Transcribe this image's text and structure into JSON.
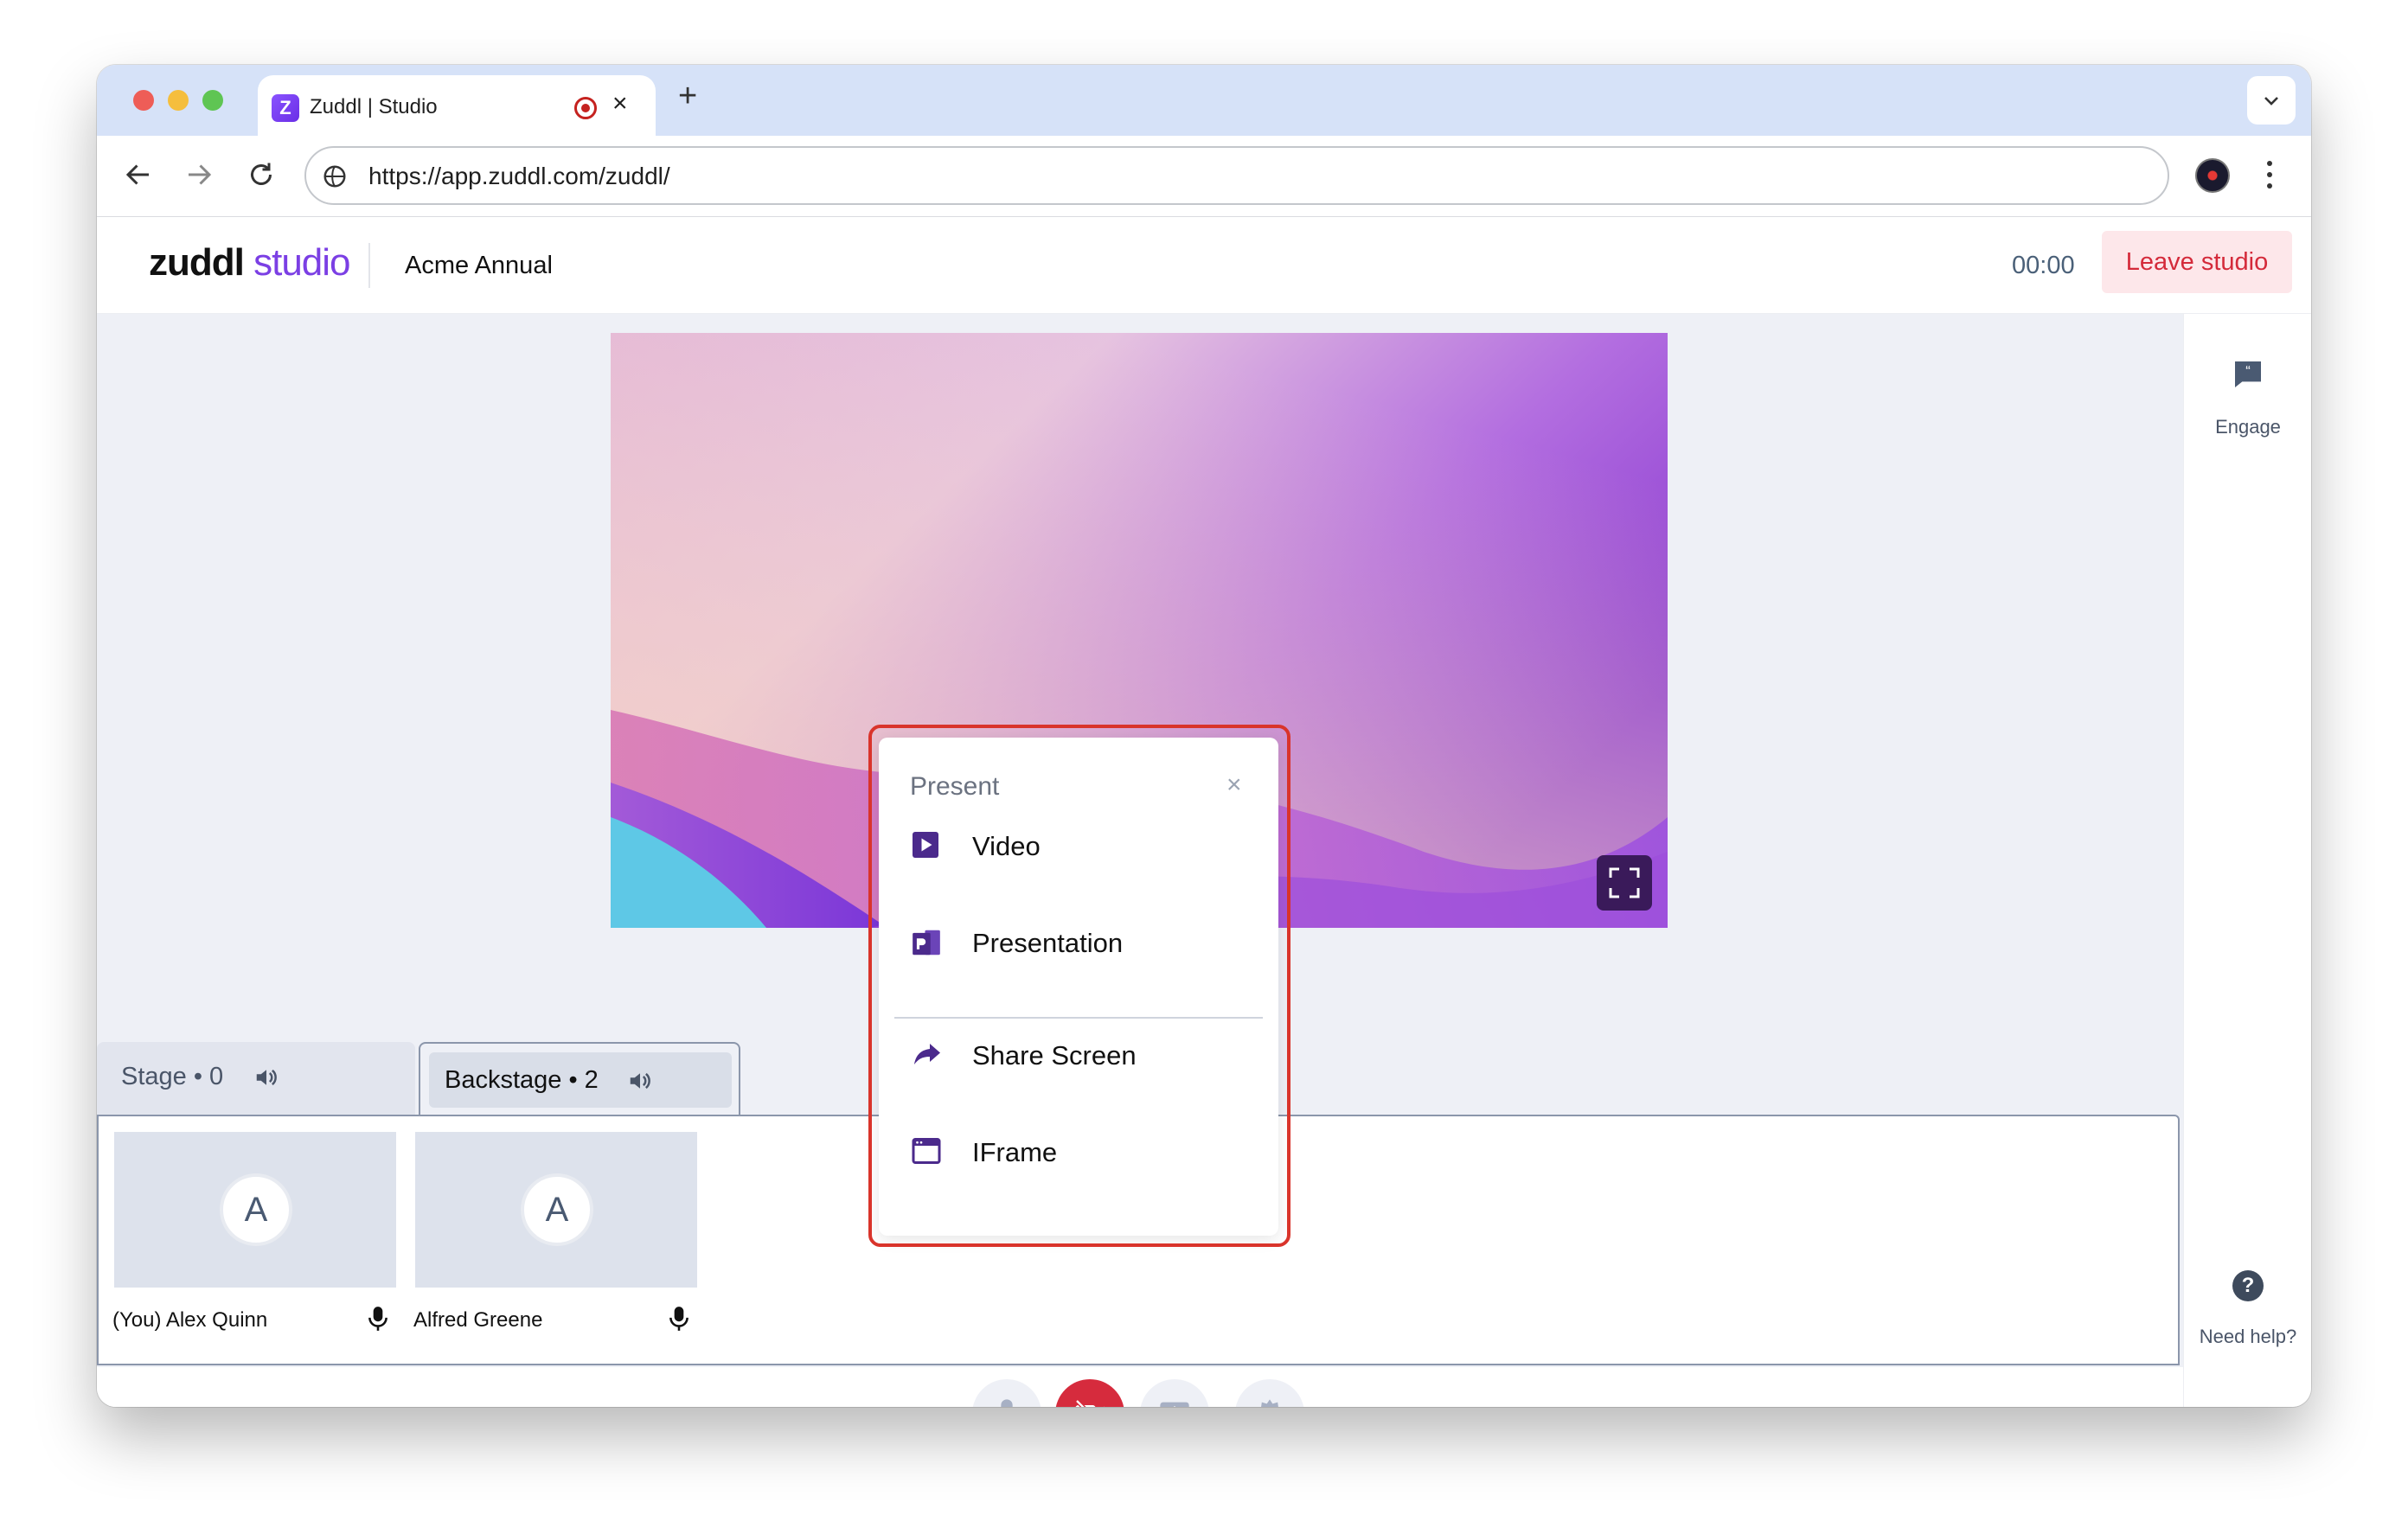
{
  "browser": {
    "tab_title": "Zuddl | Studio",
    "tab_favicon_letter": "Z",
    "url": "https://app.zuddl.com/zuddl/"
  },
  "header": {
    "logo_bold": "zuddl",
    "logo_light": "studio",
    "event_name": "Acme Annual",
    "timer": "00:00",
    "leave_label": "Leave studio"
  },
  "tabs": {
    "stage": "Stage • 0",
    "backstage": "Backstage • 2"
  },
  "participants": [
    {
      "initial": "A",
      "name": "(You) Alex Quinn"
    },
    {
      "initial": "A",
      "name": "Alfred Greene"
    }
  ],
  "right_rail": {
    "engage": "Engage",
    "help": "Need help?",
    "help_glyph": "?"
  },
  "present_menu": {
    "title": "Present",
    "close": "×",
    "items": [
      {
        "label": "Video",
        "icon": "video-play-icon"
      },
      {
        "label": "Presentation",
        "icon": "presentation-icon"
      },
      {
        "label": "Share Screen",
        "icon": "share-arrow-icon"
      },
      {
        "label": "IFrame",
        "icon": "iframe-window-icon"
      }
    ]
  },
  "colors": {
    "brand_purple": "#7b3fe4",
    "leave_red": "#d42a3a",
    "camera_off_red": "#d62b3d",
    "highlight_red": "#d9342b"
  }
}
